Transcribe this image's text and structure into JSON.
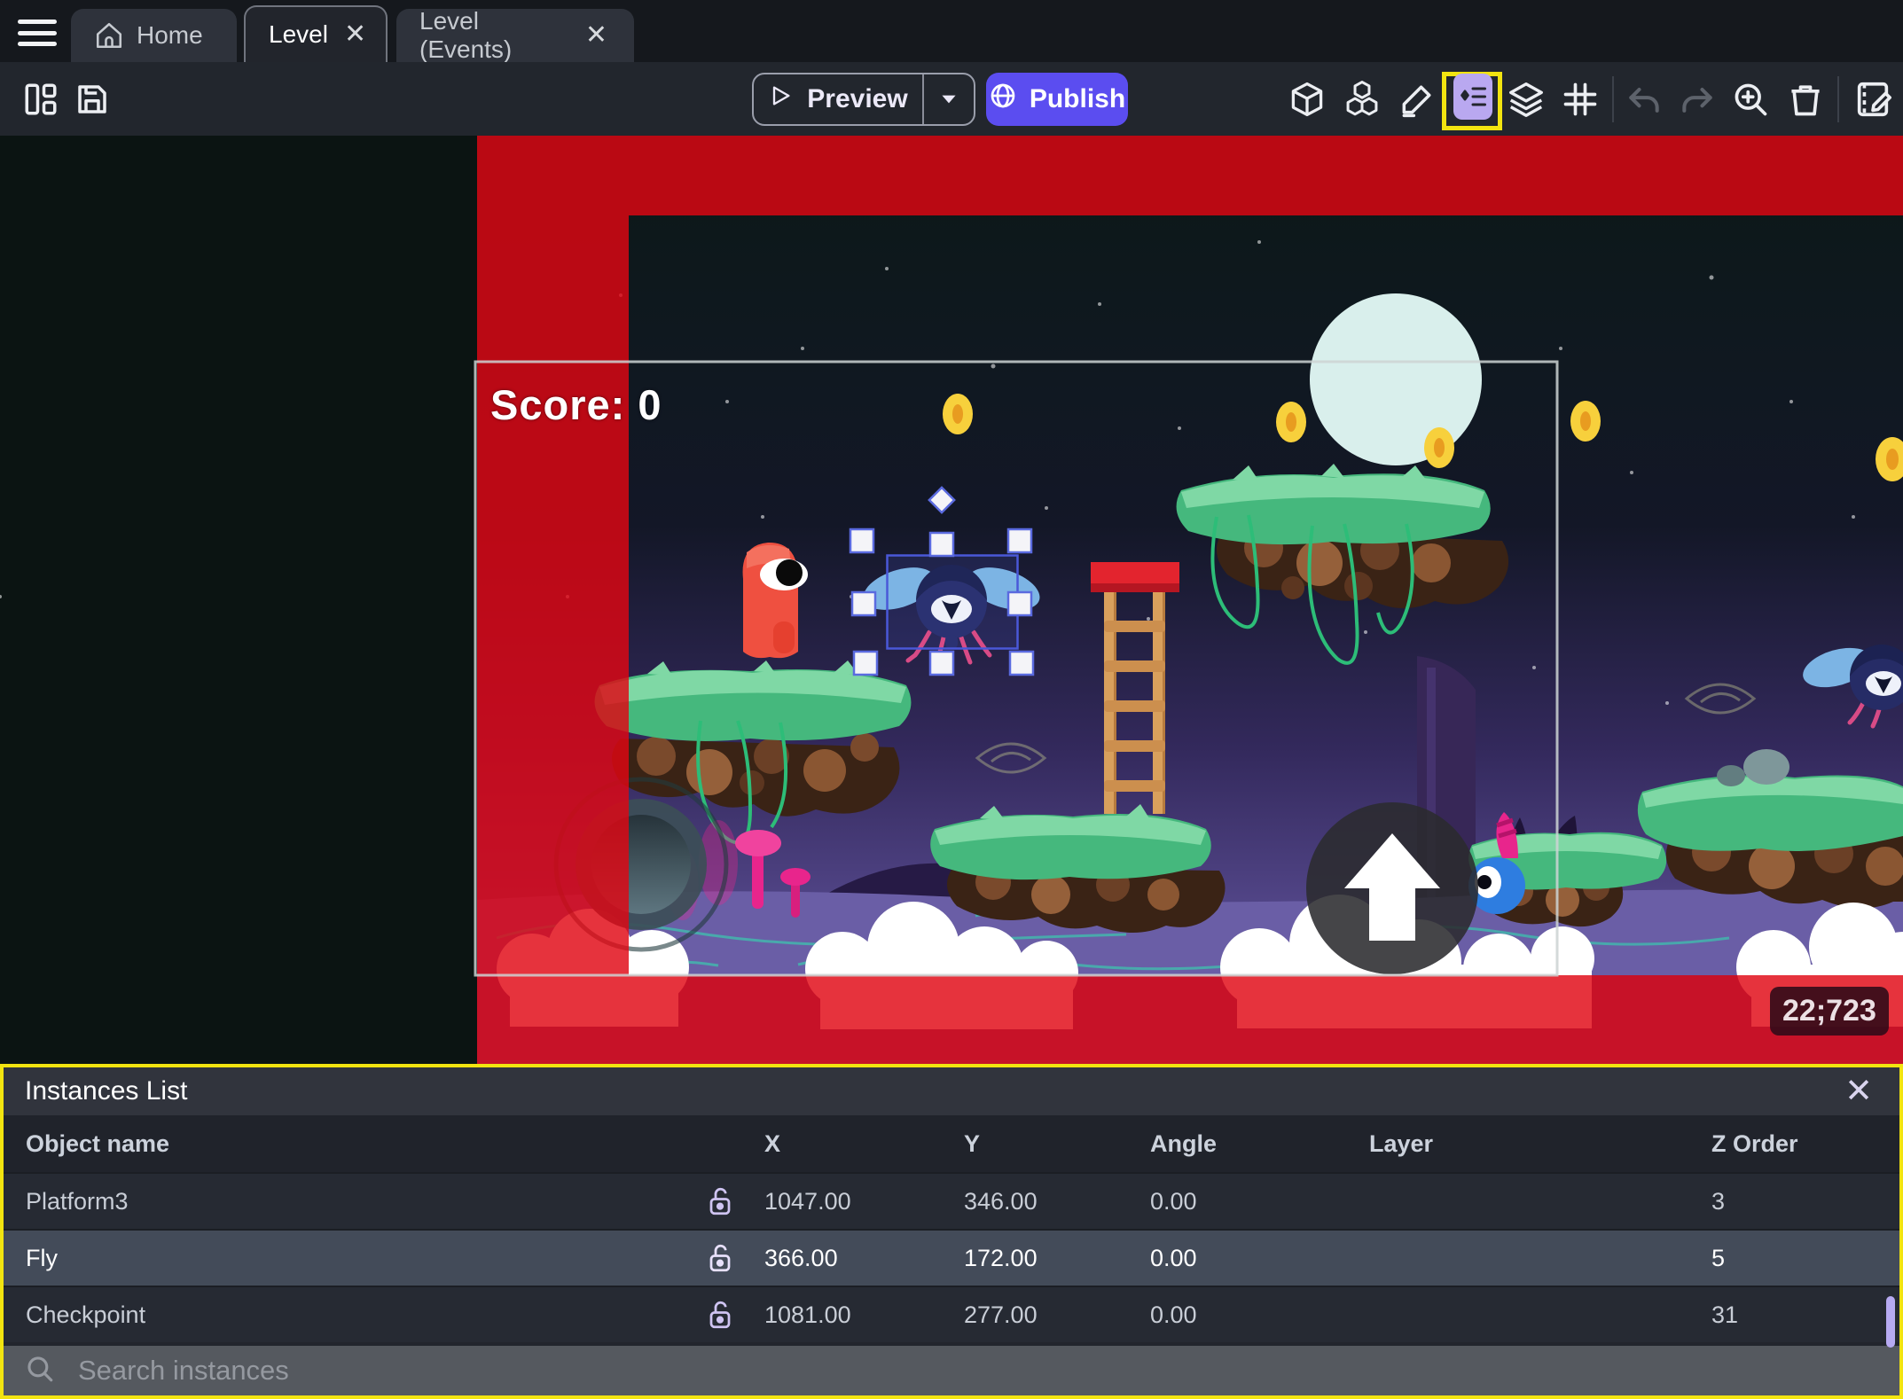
{
  "tab_bar": {
    "tabs": [
      {
        "label": "Home",
        "icon": "home-icon",
        "active": false,
        "closable": false
      },
      {
        "label": "Level",
        "active": true,
        "closable": true,
        "close_glyph": "✕"
      },
      {
        "label": "Level (Events)",
        "active": false,
        "closable": true,
        "close_glyph": "✕"
      }
    ]
  },
  "toolbar": {
    "preview_label": "Preview",
    "publish_label": "Publish",
    "accent_color": "#5b4df0",
    "highlight_color": "#f2e410",
    "icons": [
      "layout-icon",
      "save-icon",
      "play-icon",
      "caret-down-icon",
      "globe-icon",
      "cube-3d-icon",
      "objects-cubes-icon",
      "pencil-icon",
      "instances-list-icon",
      "layers-icon",
      "grid-icon",
      "undo-icon",
      "redo-icon",
      "zoom-in-icon",
      "trash-icon",
      "edit-scene-icon"
    ]
  },
  "canvas": {
    "score_label": "Score: 0",
    "coordinates_badge": "22;723",
    "red_overlay_color": "#e00612",
    "selected_object": "Fly"
  },
  "instances_panel": {
    "title": "Instances List",
    "close_glyph": "✕",
    "columns": [
      "Object name",
      "X",
      "Y",
      "Angle",
      "Layer",
      "Z Order"
    ],
    "rows": [
      {
        "name": "Platform3",
        "lock": "unlocked",
        "x": "1047.00",
        "y": "346.00",
        "angle": "0.00",
        "layer": "",
        "z_order": "3",
        "selected": false
      },
      {
        "name": "Fly",
        "lock": "unlocked",
        "x": "366.00",
        "y": "172.00",
        "angle": "0.00",
        "layer": "",
        "z_order": "5",
        "selected": true
      },
      {
        "name": "Checkpoint",
        "lock": "unlocked",
        "x": "1081.00",
        "y": "277.00",
        "angle": "0.00",
        "layer": "",
        "z_order": "31",
        "selected": false
      }
    ],
    "search_placeholder": "Search instances"
  }
}
